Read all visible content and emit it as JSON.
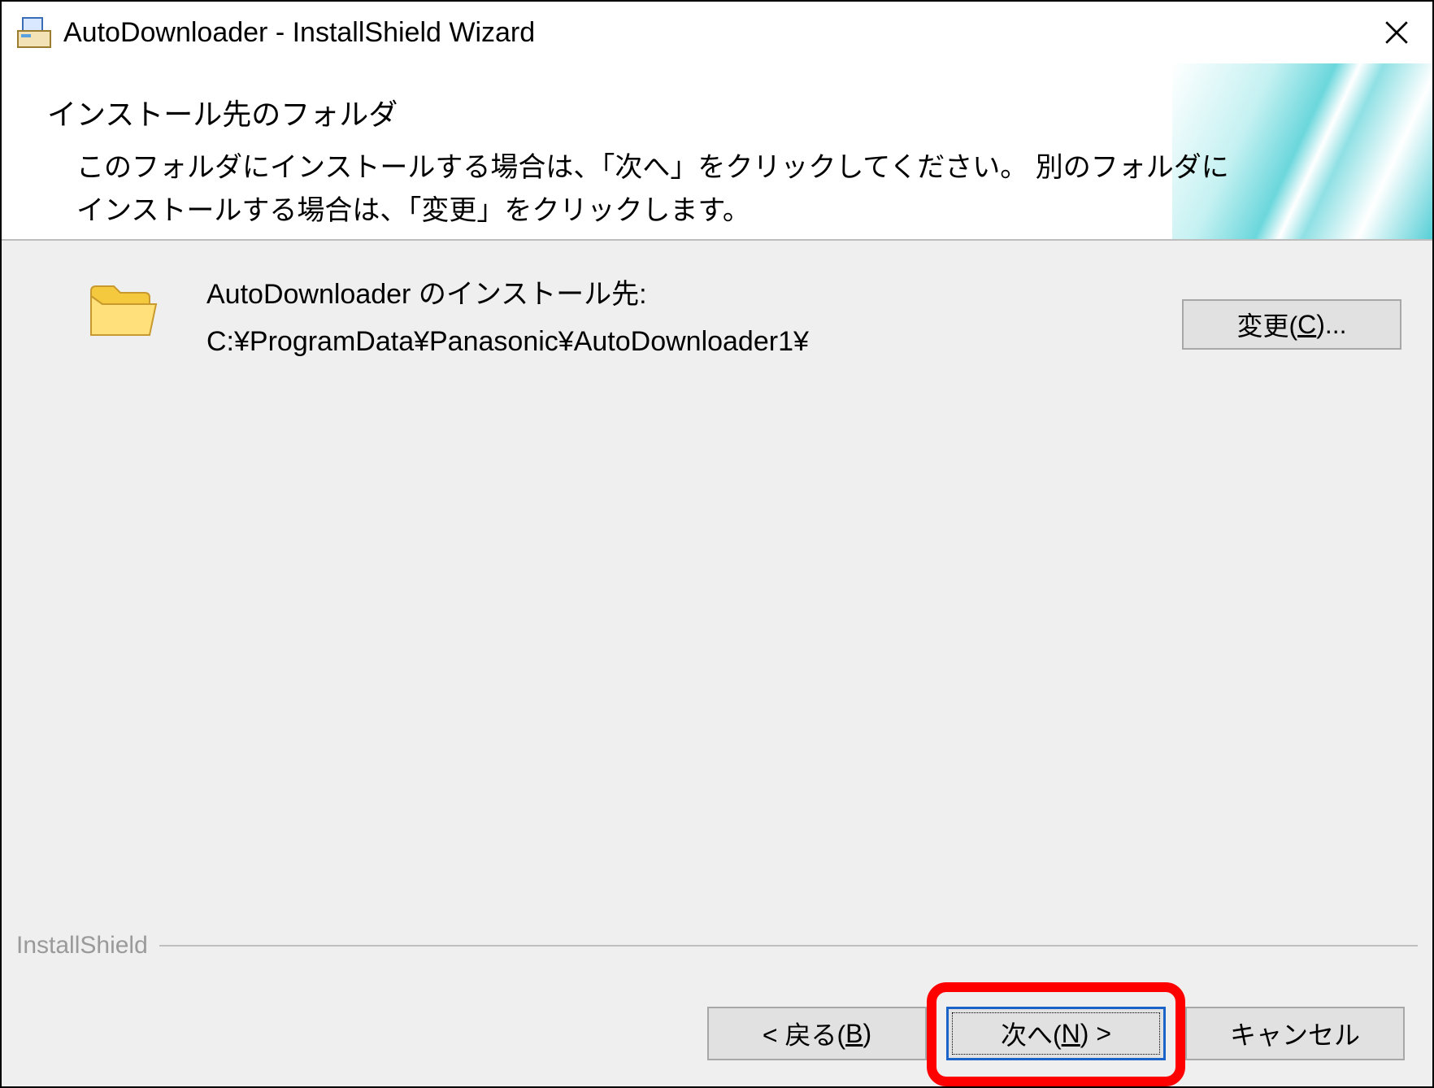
{
  "titlebar": {
    "title": "AutoDownloader - InstallShield Wizard"
  },
  "header": {
    "page_title": "インストール先のフォルダ",
    "subtitle": "このフォルダにインストールする場合は、「次へ」をクリックしてください。 別のフォルダにインストールする場合は、「変更」をクリックします。"
  },
  "content": {
    "install_to_label": "AutoDownloader のインストール先:",
    "install_path": "C:¥ProgramData¥Panasonic¥AutoDownloader1¥",
    "change_button_prefix": "変更(",
    "change_button_key": "C",
    "change_button_suffix": ")..."
  },
  "footer": {
    "brand": "InstallShield",
    "back_prefix": "< 戻る(",
    "back_key": "B",
    "back_suffix": ")",
    "next_prefix": "次へ(",
    "next_key": "N",
    "next_suffix": ") >",
    "cancel": "キャンセル"
  }
}
